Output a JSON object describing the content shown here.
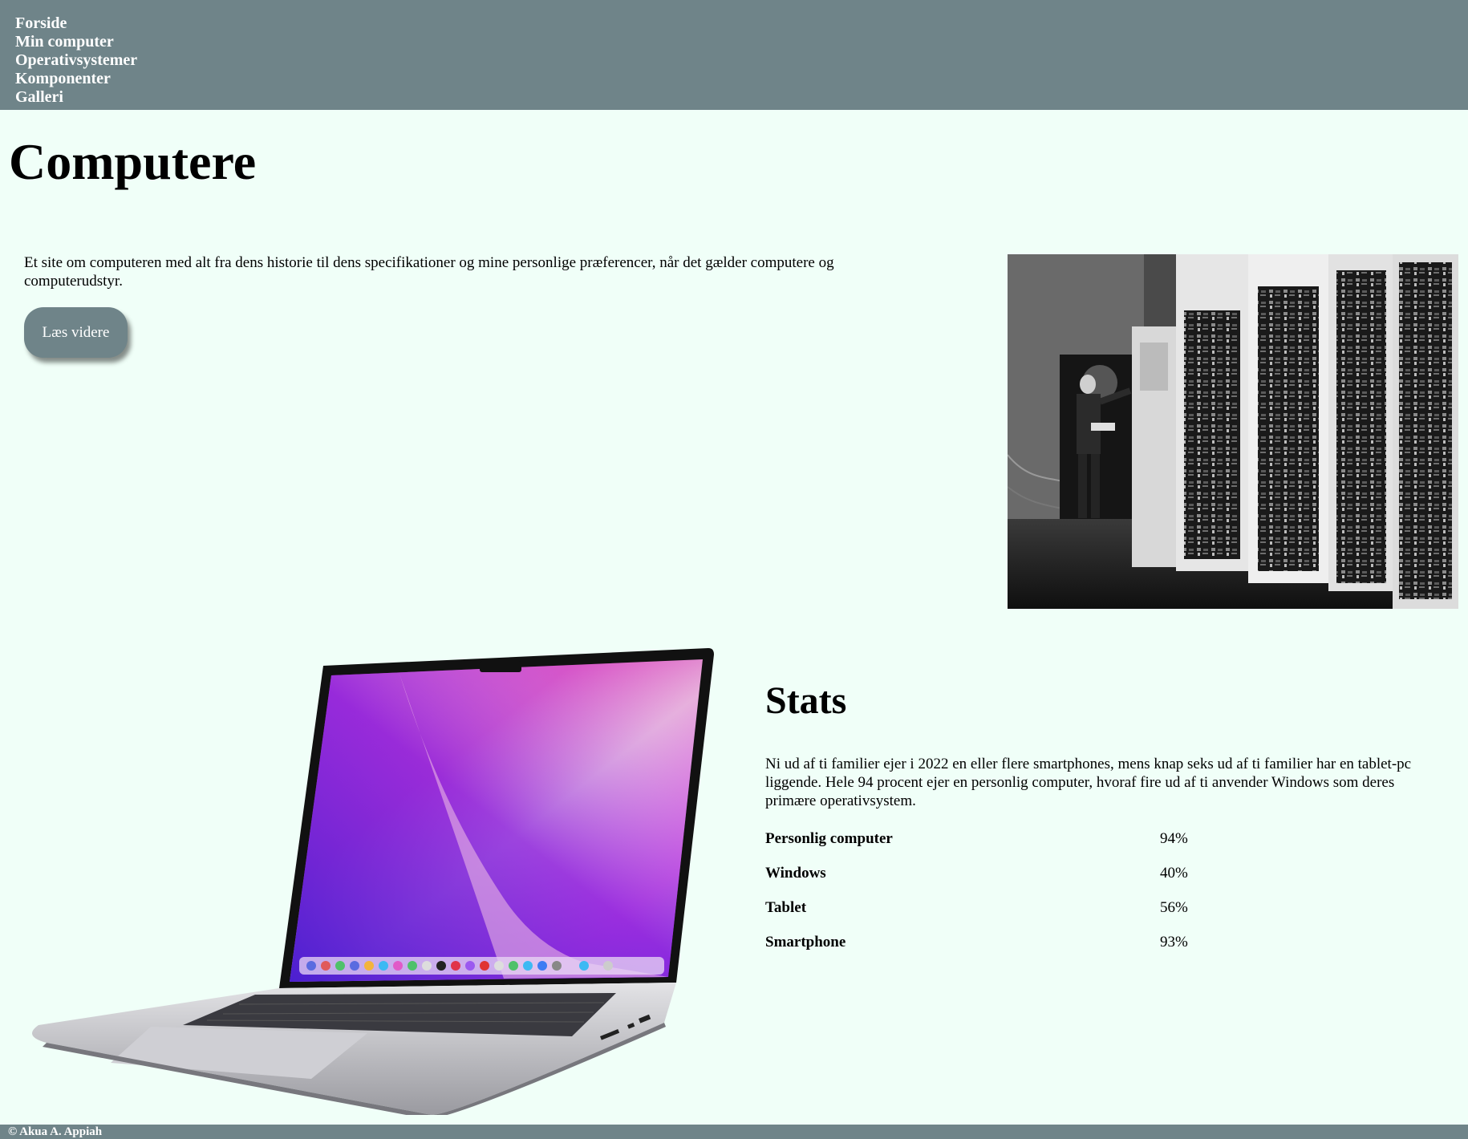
{
  "nav": {
    "items": [
      {
        "label": "Forside"
      },
      {
        "label": "Min computer"
      },
      {
        "label": "Operativsystemer"
      },
      {
        "label": "Komponenter"
      },
      {
        "label": "Galleri"
      }
    ]
  },
  "hero": {
    "title": "Computere",
    "intro": "Et site om computeren med alt fra dens historie til dens specifikationer og mine personlige præferencer, når det gælder computere og computerudstyr.",
    "read_more_label": "Læs videre"
  },
  "stats": {
    "heading": "Stats",
    "text": "Ni ud af ti familier ejer i 2022 en eller flere smartphones, mens knap seks ud af ti familier har en tablet-pc liggende. Hele 94 procent ejer en personlig computer, hvoraf fire ud af ti anvender Windows som deres primære operativsystem.",
    "rows": [
      {
        "label": "Personlig computer",
        "value": "94%"
      },
      {
        "label": "Windows",
        "value": "40%"
      },
      {
        "label": "Tablet",
        "value": "56%"
      },
      {
        "label": "Smartphone",
        "value": "93%"
      }
    ]
  },
  "footer": {
    "copyright": "© Akua A. Appiah"
  },
  "colors": {
    "nav_background": "#6f8489",
    "page_background": "#f0fff8",
    "button_background": "#6f8489"
  }
}
